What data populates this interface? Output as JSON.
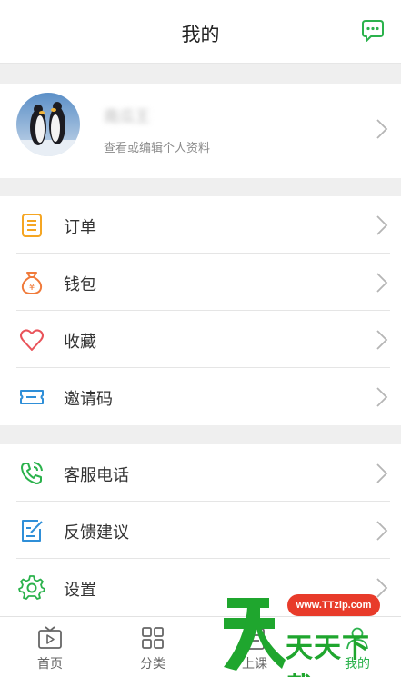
{
  "header": {
    "title": "我的",
    "message_icon": "chat-bubble-icon"
  },
  "profile": {
    "name": "南瓜王",
    "hint": "查看或编辑个人资料"
  },
  "groups": [
    {
      "items": [
        {
          "label": "订单",
          "icon": "order-list-icon",
          "color": "#f5a623"
        },
        {
          "label": "钱包",
          "icon": "money-bag-icon",
          "color": "#f07a3a"
        },
        {
          "label": "收藏",
          "icon": "heart-icon",
          "color": "#e9535a"
        },
        {
          "label": "邀请码",
          "icon": "ticket-icon",
          "color": "#2f8fd8"
        }
      ]
    },
    {
      "items": [
        {
          "label": "客服电话",
          "icon": "phone-icon",
          "color": "#2bb24c"
        },
        {
          "label": "反馈建议",
          "icon": "feedback-edit-icon",
          "color": "#2f8fd8"
        },
        {
          "label": "设置",
          "icon": "gear-icon",
          "color": "#2bb24c"
        }
      ]
    }
  ],
  "tabbar": [
    {
      "label": "首页",
      "icon": "tv-play-icon"
    },
    {
      "label": "分类",
      "icon": "grid-icon"
    },
    {
      "label": "上课",
      "icon": "class-icon"
    },
    {
      "label": "我的",
      "icon": "user-icon",
      "active": true
    }
  ],
  "watermark": {
    "url": "www.TTzip.com",
    "text": "天天下载"
  },
  "colors": {
    "accent": "#2bb24c",
    "background": "#efefef"
  }
}
